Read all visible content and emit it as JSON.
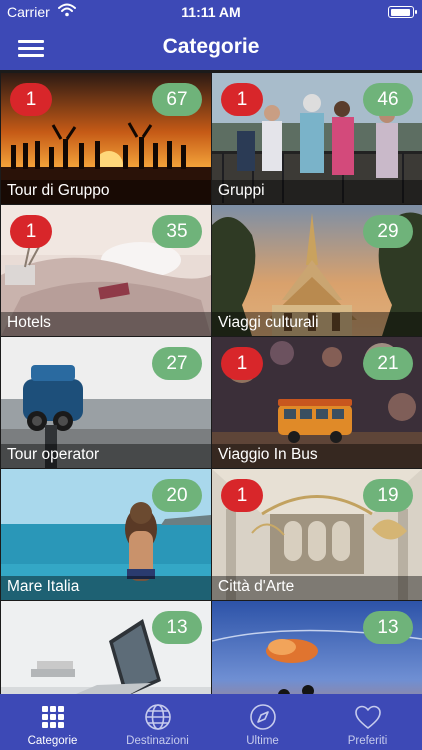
{
  "status_bar": {
    "carrier": "Carrier",
    "time": "11:11 AM",
    "battery_level": 0.95
  },
  "nav": {
    "title": "Categorie",
    "menu_icon": "hamburger-menu-icon"
  },
  "categories": [
    {
      "label": "Tour di Gruppo",
      "count": "67",
      "new": "1"
    },
    {
      "label": "Gruppi",
      "count": "46",
      "new": "1"
    },
    {
      "label": "Hotels",
      "count": "35",
      "new": "1"
    },
    {
      "label": "Viaggi culturali",
      "count": "29",
      "new": ""
    },
    {
      "label": "Tour operator",
      "count": "27",
      "new": ""
    },
    {
      "label": "Viaggio In Bus",
      "count": "21",
      "new": "1"
    },
    {
      "label": "Mare Italia",
      "count": "20",
      "new": ""
    },
    {
      "label": "Città d'Arte",
      "count": "19",
      "new": "1"
    },
    {
      "label": "",
      "count": "13",
      "new": ""
    },
    {
      "label": "",
      "count": "13",
      "new": ""
    }
  ],
  "tabs": [
    {
      "label": "Categorie",
      "icon": "grid-icon",
      "active": true
    },
    {
      "label": "Destinazioni",
      "icon": "globe-icon",
      "active": false
    },
    {
      "label": "Ultime",
      "icon": "compass-icon",
      "active": false
    },
    {
      "label": "Preferiti",
      "icon": "heart-icon",
      "active": false
    }
  ],
  "colors": {
    "primary": "#3d49b6",
    "badge_new": "#d8262a",
    "badge_count": "#6fb37a",
    "tab_inactive": "#c6cbed"
  }
}
